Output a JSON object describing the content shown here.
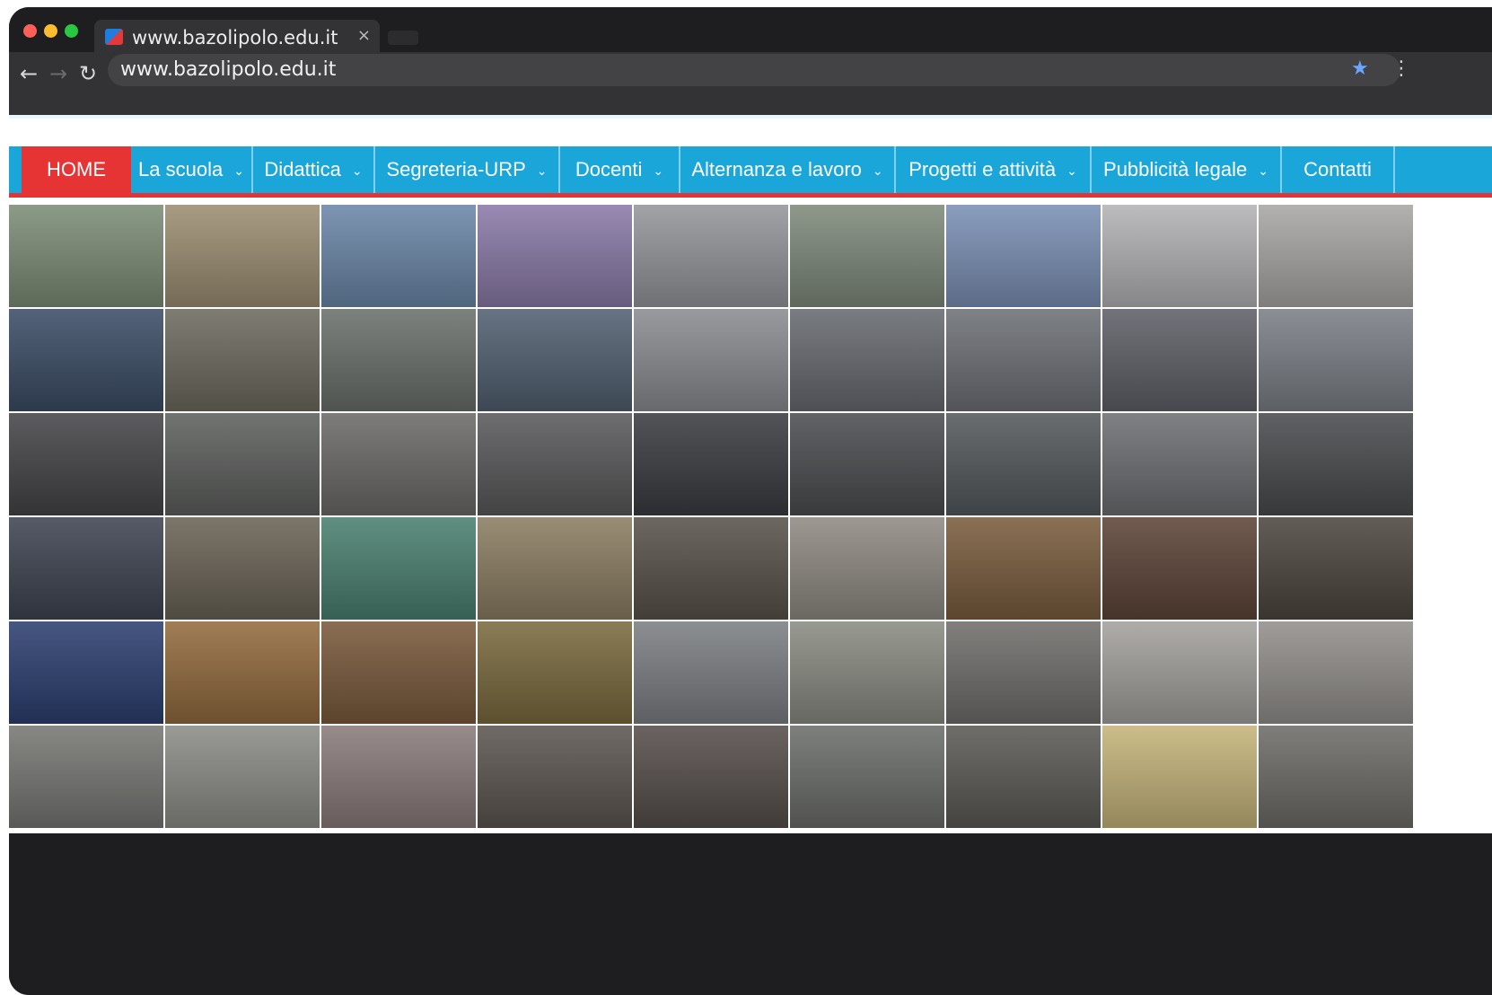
{
  "browser": {
    "tab_title": "www.bazolipolo.edu.it",
    "tab_close": "×",
    "url": "www.bazolipolo.edu.it",
    "back_icon": "←",
    "forward_icon": "→",
    "reload_icon": "↻",
    "bookmark_icon": "★",
    "menu_icon": "⋮",
    "colors": {
      "close": "#fe5f57",
      "minimize": "#febc2e",
      "maximize": "#28c840"
    }
  },
  "nav": {
    "items": [
      {
        "label": "HOME"
      },
      {
        "label": "La scuola"
      },
      {
        "label": "Didattica"
      },
      {
        "label": "Segreteria-URP"
      },
      {
        "label": "Docenti"
      },
      {
        "label": "Alternanza e lavoro"
      },
      {
        "label": "Progetti e attività"
      },
      {
        "label": "Pubblicità legale"
      },
      {
        "label": "Contatti"
      }
    ],
    "dropdown_icon": "⌄"
  },
  "gallery": {
    "rows": 6,
    "columns": 9,
    "tiles": [
      [
        "#7c8d76",
        "#9c8e72",
        "#6b87a8",
        "#8a7aa8",
        "#94969a",
        "#7f8a7b",
        "#7b90b5",
        "#b3b3b6",
        "#a9a7a5"
      ],
      [
        "#3c4d66",
        "#6d6b5f",
        "#6a706c",
        "#526071",
        "#8a8c90",
        "#676a70",
        "#6d7076",
        "#5f6068",
        "#7b7f86"
      ],
      [
        "#454447",
        "#5e605e",
        "#6b6a68",
        "#59595b",
        "#3a3c40",
        "#4b4d50",
        "#55595c",
        "#6d6f72",
        "#4a4b4e"
      ],
      [
        "#3e4452",
        "#6a6356",
        "#4a8070",
        "#8b7d62",
        "#58524a",
        "#8f8a82",
        "#7a5d3e",
        "#5d4438",
        "#4c463e"
      ],
      [
        "#2c3f70",
        "#936b3e",
        "#7a5a3c",
        "#7a6a3e",
        "#7c7f83",
        "#8a8b82",
        "#6f6e6b",
        "#a2a19d",
        "#928f8c"
      ],
      [
        "#777874",
        "#8c8c87",
        "#8a7b7b",
        "#5c5650",
        "#564e4c",
        "#6c6e6b",
        "#5b5a55",
        "#c5b47a",
        "#6d6c68"
      ]
    ]
  }
}
